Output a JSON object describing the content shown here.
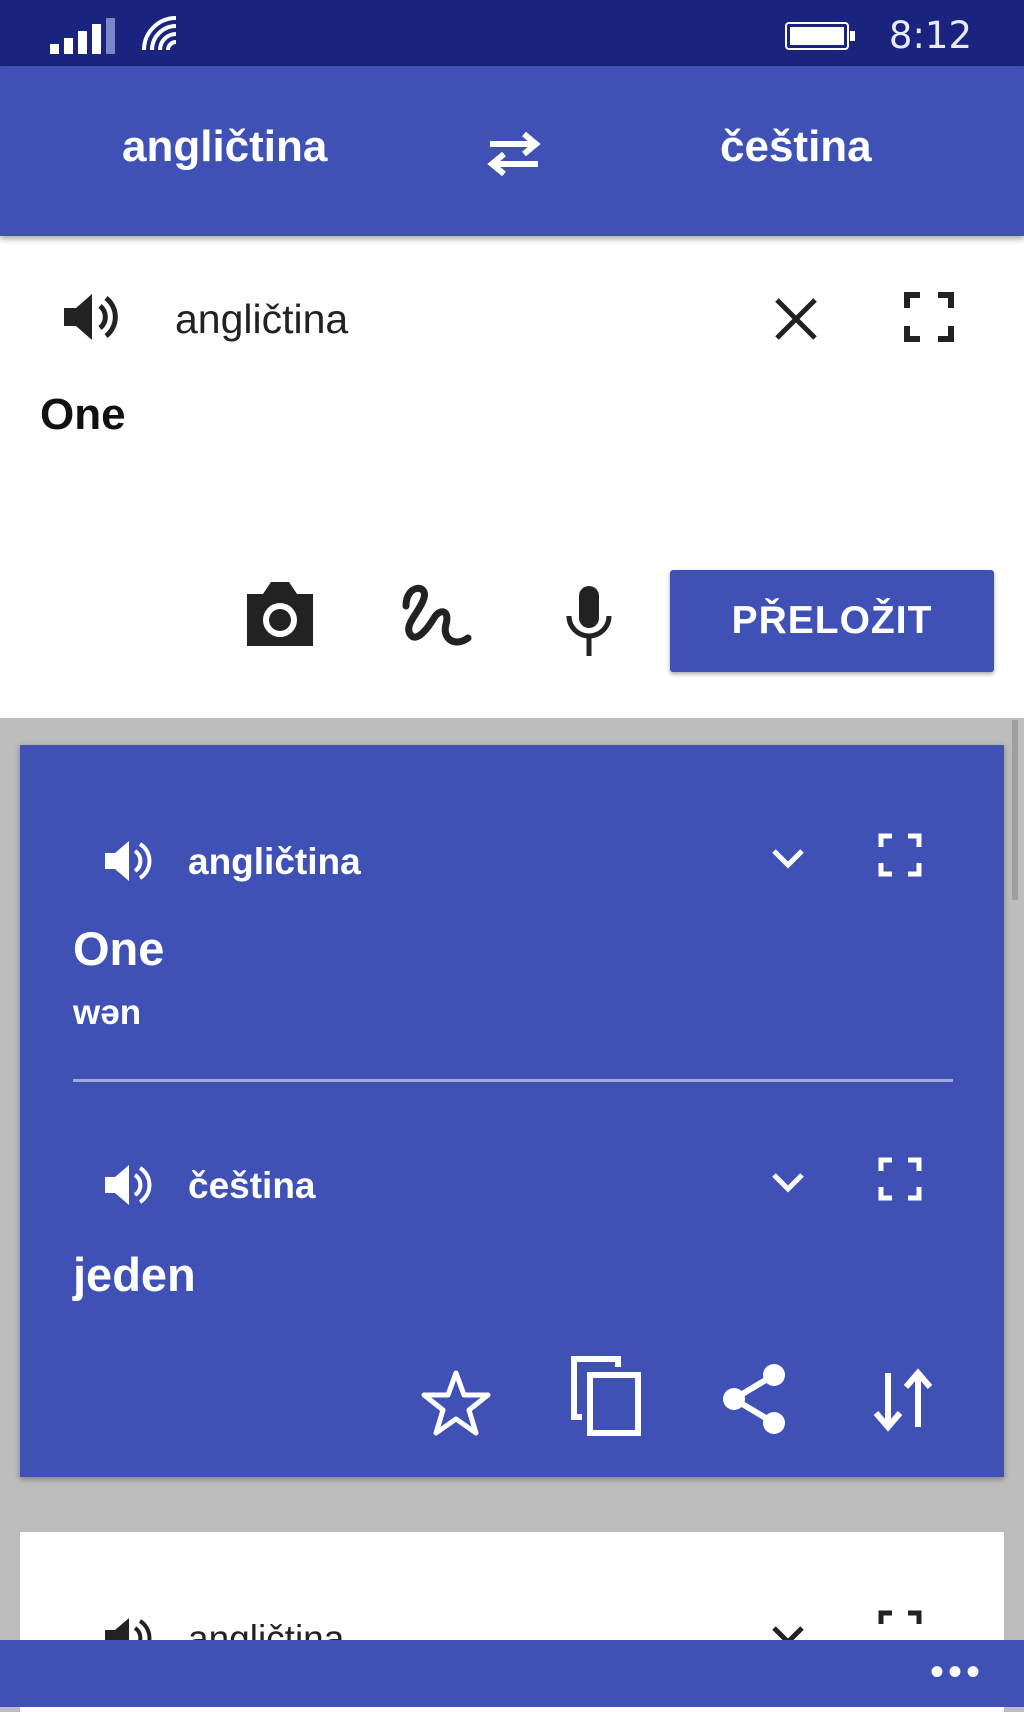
{
  "status_bar": {
    "time": "8:12"
  },
  "header": {
    "source_language": "angličtina",
    "target_language": "čeština"
  },
  "input": {
    "language": "angličtina",
    "text": "One",
    "translate_label": "PŘELOŽIT"
  },
  "result": {
    "source_language": "angličtina",
    "source_text": "One",
    "transliteration": "wən",
    "target_language": "čeština",
    "target_text": "jeden"
  },
  "history": {
    "language": "angličtina"
  },
  "bottom_bar": {
    "more_label": "•••"
  },
  "colors": {
    "primary": "#3f51b5",
    "status_bar": "#1a237e",
    "background": "#bdbdbd"
  }
}
